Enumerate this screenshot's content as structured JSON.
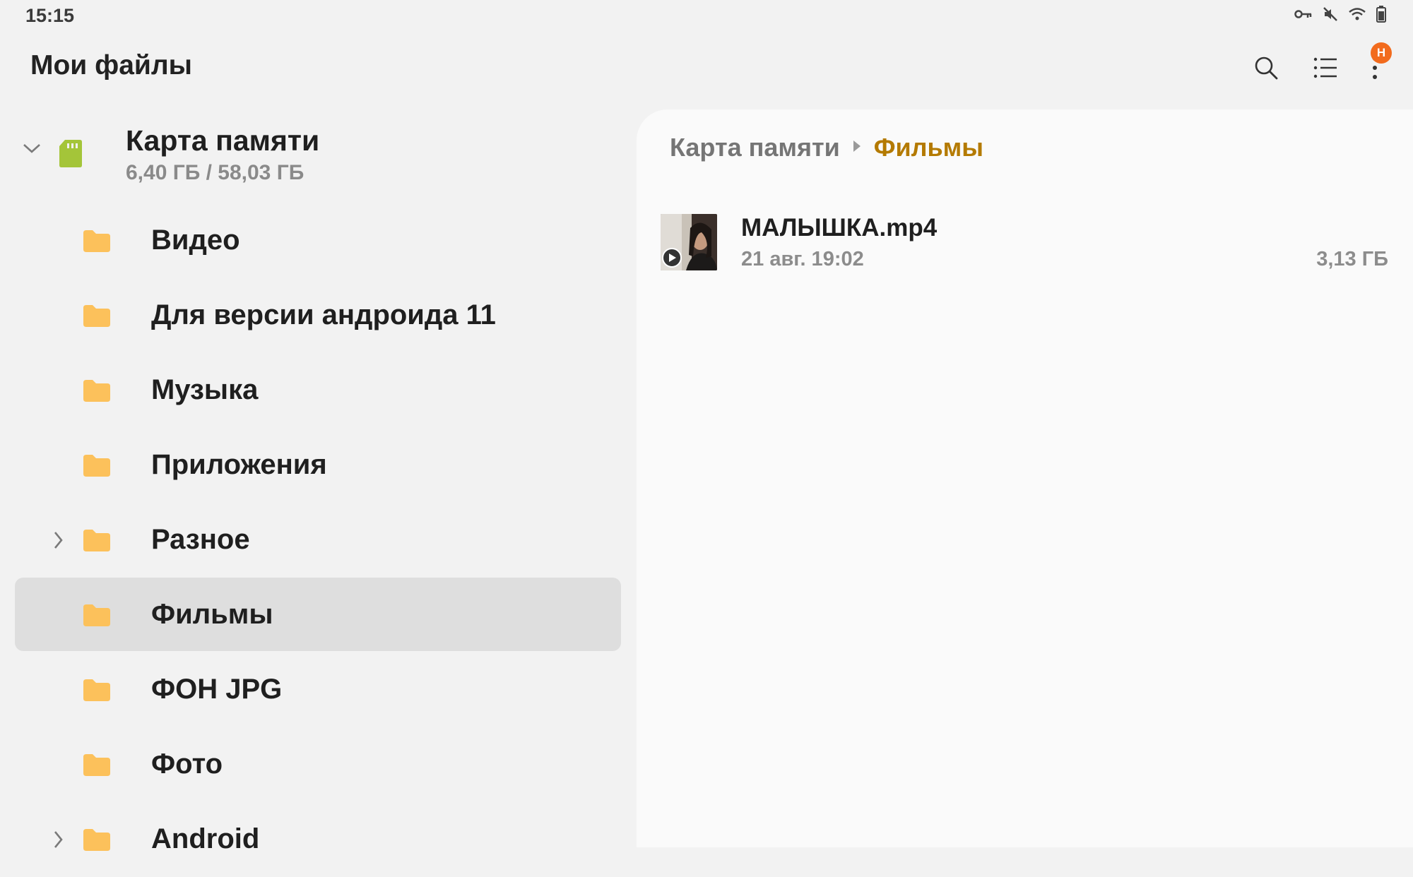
{
  "status_bar": {
    "time": "15:15",
    "icons": [
      "vpn-key-icon",
      "mute-icon",
      "wifi-icon",
      "battery-icon"
    ]
  },
  "app_bar": {
    "title": "Мои файлы",
    "actions": [
      "search-icon",
      "list-view-icon",
      "more-options-icon"
    ],
    "badge": "Н"
  },
  "storage": {
    "name": "Карта памяти",
    "usage": "6,40 ГБ / 58,03 ГБ"
  },
  "folders": [
    {
      "label": "Видео",
      "expandable": false
    },
    {
      "label": "Для версии андроида 11",
      "expandable": false
    },
    {
      "label": "Музыка",
      "expandable": false
    },
    {
      "label": "Приложения",
      "expandable": false
    },
    {
      "label": "Разное",
      "expandable": true
    },
    {
      "label": "Фильмы",
      "expandable": false,
      "selected": true
    },
    {
      "label": "ФОН JPG",
      "expandable": false
    },
    {
      "label": "Фото",
      "expandable": false
    },
    {
      "label": "Android",
      "expandable": true
    }
  ],
  "breadcrumb": {
    "items": [
      "Карта памяти",
      "Фильмы"
    ]
  },
  "files": [
    {
      "name": "МАЛЫШКА.mp4",
      "date": "21 авг. 19:02",
      "size": "3,13 ГБ"
    }
  ],
  "colors": {
    "folder": "#fcc15b",
    "sd_card": "#a4c539",
    "breadcrumb_active": "#b47a00",
    "badge": "#f26b1d",
    "selected_bg": "#dedede"
  }
}
